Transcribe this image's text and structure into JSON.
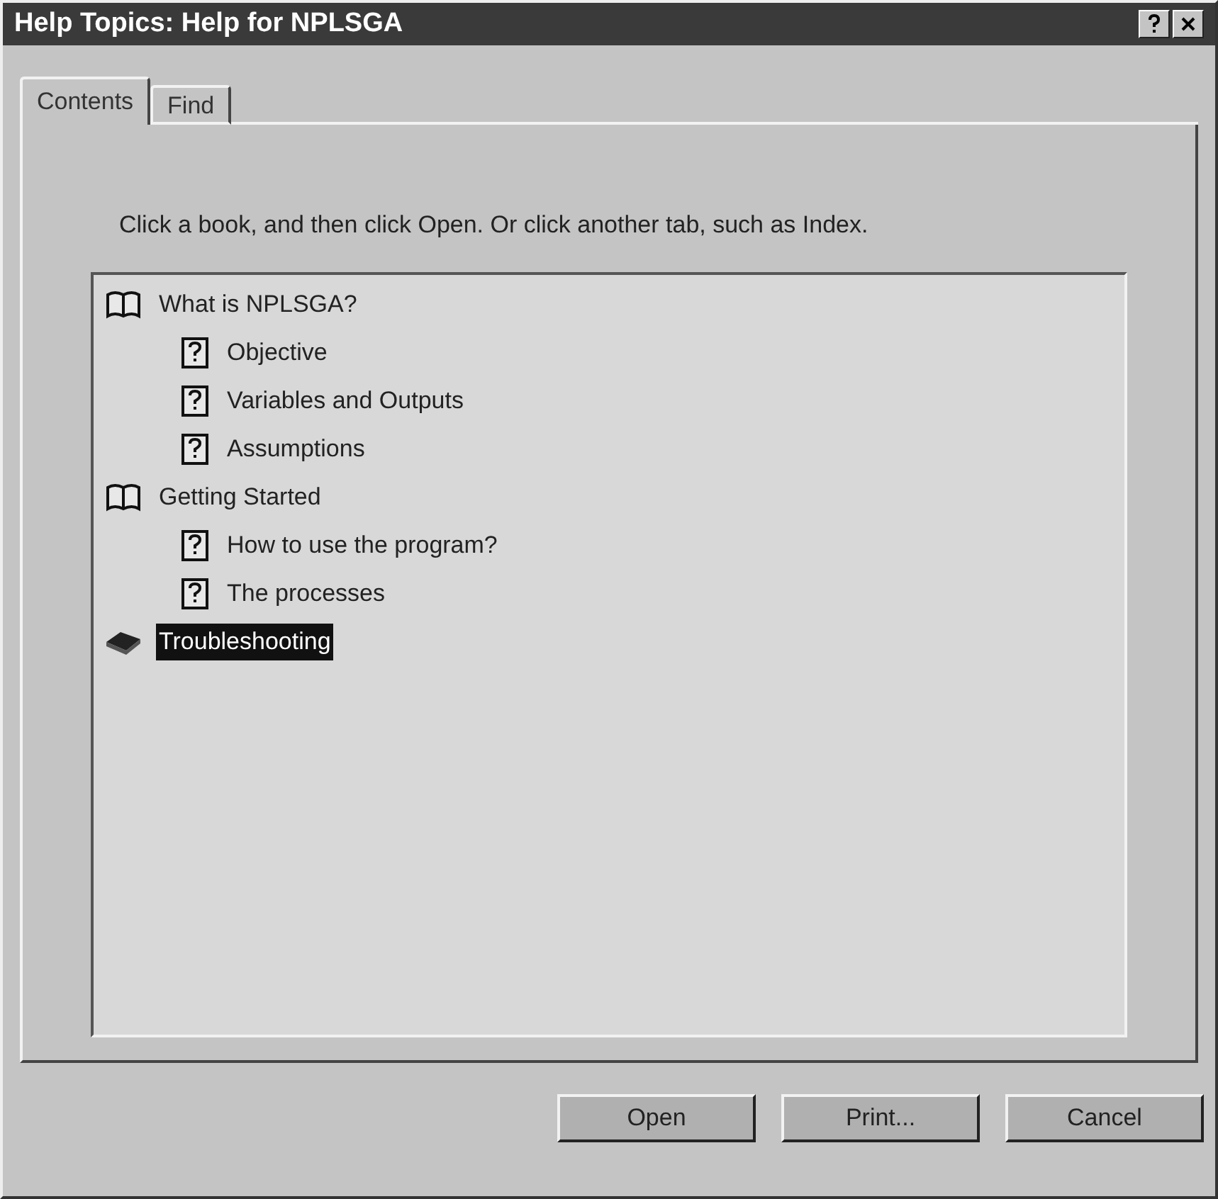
{
  "window": {
    "title": "Help Topics: Help for NPLSGA"
  },
  "tabs": [
    {
      "label": "Contents",
      "selected": true
    },
    {
      "label": "Find",
      "selected": false
    }
  ],
  "instruction": "Click a book, and then click Open. Or click another tab, such as Index.",
  "tree": [
    {
      "kind": "book",
      "label": "What is NPLSGA?",
      "expanded": true,
      "selected": false,
      "children": [
        {
          "kind": "topic",
          "label": "Objective",
          "selected": false
        },
        {
          "kind": "topic",
          "label": "Variables and Outputs",
          "selected": false
        },
        {
          "kind": "topic",
          "label": "Assumptions",
          "selected": false
        }
      ]
    },
    {
      "kind": "book",
      "label": "Getting Started",
      "expanded": true,
      "selected": false,
      "children": [
        {
          "kind": "topic",
          "label": "How to use the program?",
          "selected": false
        },
        {
          "kind": "topic",
          "label": "The processes",
          "selected": false
        }
      ]
    },
    {
      "kind": "book",
      "label": "Troubleshooting",
      "expanded": false,
      "selected": true
    }
  ],
  "buttons": [
    {
      "label": "Open"
    },
    {
      "label": "Print..."
    },
    {
      "label": "Cancel"
    }
  ]
}
